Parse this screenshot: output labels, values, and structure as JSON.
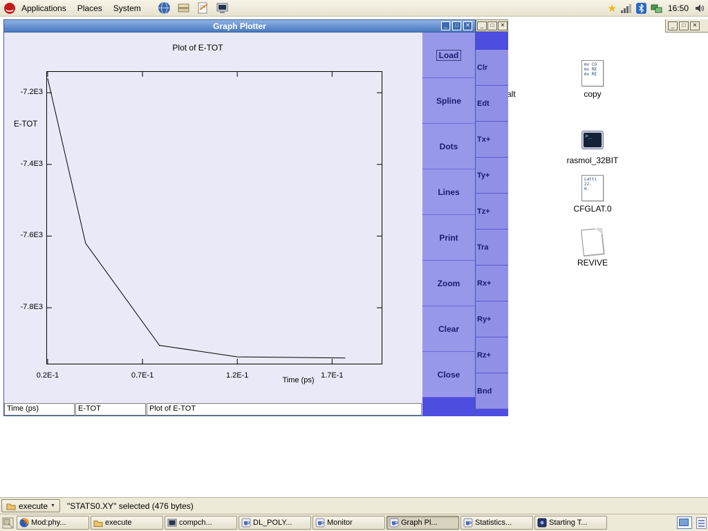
{
  "panel": {
    "menus": [
      "Applications",
      "Places",
      "System"
    ],
    "clock": "16:50"
  },
  "graph_window": {
    "title": "Graph Plotter",
    "buttons": [
      "Load",
      "Spline",
      "Dots",
      "Lines",
      "Print",
      "Zoom",
      "Clear",
      "Close"
    ],
    "status_fields": [
      "Time (ps)",
      "E-TOT",
      "Plot of E-TOT"
    ]
  },
  "chart_data": {
    "type": "line",
    "title": "Plot of E-TOT",
    "xlabel": "Time (ps)",
    "ylabel": "E-TOT",
    "x_tick_labels": [
      "0.2E-1",
      "0.7E-1",
      "1.2E-1",
      "1.7E-1"
    ],
    "x_tick_values": [
      0.02,
      0.07,
      0.12,
      0.17
    ],
    "y_tick_labels": [
      "-7.2E3",
      "-7.4E3",
      "-7.6E3",
      "-7.8E3"
    ],
    "y_tick_values": [
      -7200,
      -7400,
      -7600,
      -7800
    ],
    "xlim": [
      0.0193,
      0.1965
    ],
    "ylim": [
      -7958,
      -7140
    ],
    "grid": false,
    "legend": false,
    "series": [
      {
        "name": "E-TOT",
        "x": [
          0.02,
          0.04,
          0.079,
          0.12,
          0.177
        ],
        "y": [
          -7160,
          -7620,
          -7905,
          -7937,
          -7940
        ]
      }
    ]
  },
  "side_window": {
    "buttons": [
      "Clr",
      "Edt",
      "Tx+",
      "Ty+",
      "Tz+",
      "Tra",
      "Rx+",
      "Ry+",
      "Rz+",
      "Bnd"
    ]
  },
  "file_view": {
    "stray_text": "alt",
    "icons": [
      {
        "label": "copy",
        "kind": "text-file",
        "preview_lines": [
          "mv CO",
          "mv RE",
          "mv RE"
        ]
      },
      {
        "label": "rasmol_32BIT",
        "kind": "terminal",
        "preview_lines": []
      },
      {
        "label": "CFGLAT.0",
        "kind": "text-file",
        "preview_lines": [
          "Latti",
          "22.",
          "0."
        ]
      },
      {
        "label": "REVIVE",
        "kind": "blank-file",
        "preview_lines": []
      }
    ]
  },
  "statusbar": {
    "location_button": "execute",
    "status_text": "\"STATS0.XY\" selected (476 bytes)"
  },
  "taskbar": {
    "tasks": [
      {
        "label": "Mod:phy...",
        "icon": "firefox",
        "active": false
      },
      {
        "label": "execute",
        "icon": "folder",
        "active": false
      },
      {
        "label": "compch...",
        "icon": "terminal",
        "active": false
      },
      {
        "label": "DL_POLY...",
        "icon": "java",
        "active": false
      },
      {
        "label": "Monitor",
        "icon": "java",
        "active": false
      },
      {
        "label": "Graph Pl...",
        "icon": "java",
        "active": true
      },
      {
        "label": "Statistics...",
        "icon": "java",
        "active": false
      },
      {
        "label": "Starting T...",
        "icon": "app",
        "active": false
      }
    ]
  }
}
